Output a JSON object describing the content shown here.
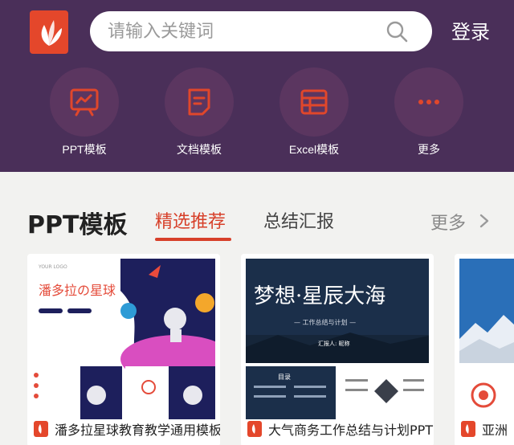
{
  "header": {
    "search_placeholder": "请输入关键词",
    "login_label": "登录"
  },
  "categories": [
    {
      "label": "PPT模板",
      "icon": "presentation-icon"
    },
    {
      "label": "文档模板",
      "icon": "document-icon"
    },
    {
      "label": "Excel模板",
      "icon": "spreadsheet-icon"
    },
    {
      "label": "更多",
      "icon": "more-icon"
    }
  ],
  "section": {
    "title": "PPT模板",
    "tabs": [
      {
        "label": "精选推荐",
        "active": true
      },
      {
        "label": "总结汇报",
        "active": false
      }
    ],
    "more_label": "更多"
  },
  "cards": [
    {
      "title": "潘多拉星球教育教学通用模板",
      "thumb_text": "潘多拉の星球",
      "thumb_small": "YOUR LOGO"
    },
    {
      "title": "大气商务工作总结与计划PPT",
      "thumb_text": "梦想·星辰大海",
      "thumb_sub": "— 工作总结与计划 —",
      "thumb_sub2": "汇报人: 昵称",
      "thumb_toc": "目录"
    },
    {
      "title": "亚洲（"
    }
  ],
  "colors": {
    "header_bg": "#4a2f59",
    "accent": "#d7402a",
    "logo": "#e4472b"
  }
}
